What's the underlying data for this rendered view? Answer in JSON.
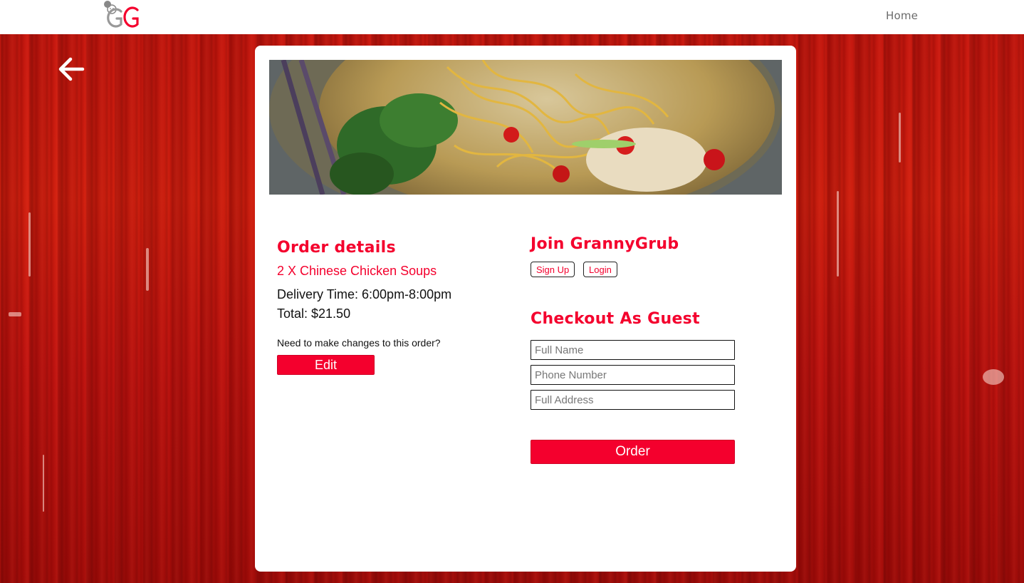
{
  "header": {
    "logo_text": "GG",
    "nav_home": "Home"
  },
  "order": {
    "title": "Order details",
    "item_line": "2 X Chinese Chicken Soups",
    "delivery_time": "Delivery Time: 6:00pm-8:00pm",
    "total": "Total: $21.50",
    "changes_prompt": "Need to make changes to this order?",
    "edit_label": "Edit"
  },
  "join": {
    "title": "Join GrannyGrub",
    "signup_label": "Sign Up",
    "login_label": "Login"
  },
  "guest": {
    "title": "Checkout As Guest",
    "name_placeholder": "Full Name",
    "phone_placeholder": "Phone Number",
    "address_placeholder": "Full Address",
    "order_label": "Order"
  },
  "colors": {
    "accent": "#f4002d",
    "background": "#c8180f"
  },
  "icons": {
    "back": "arrow-left-icon",
    "logo": "granny-grub-logo"
  }
}
